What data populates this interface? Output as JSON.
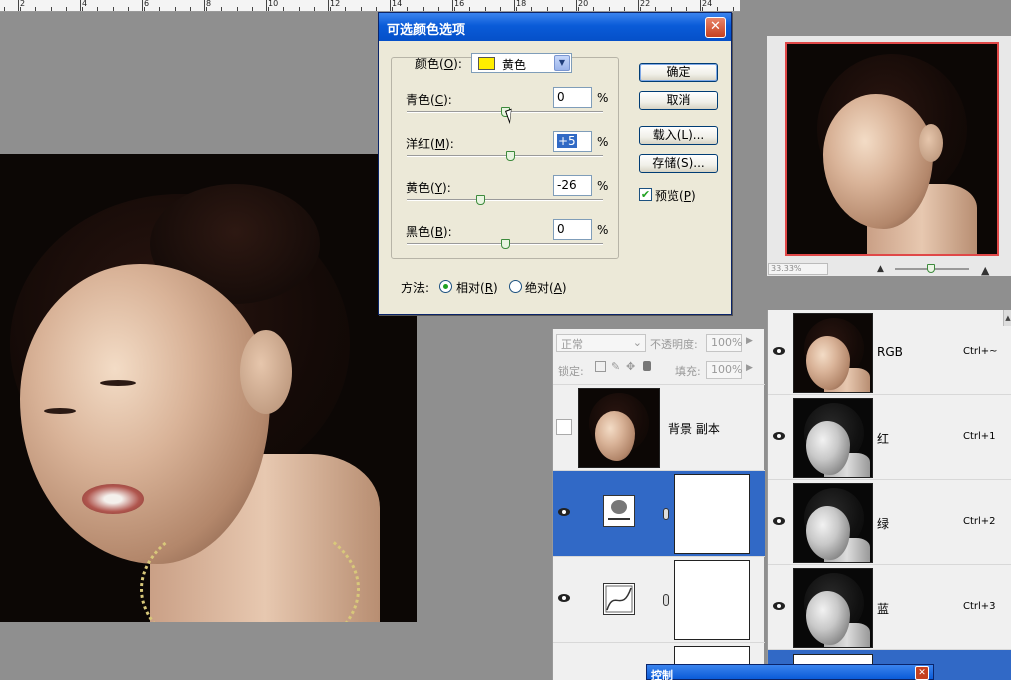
{
  "dialog": {
    "title": "可选颜色选项",
    "close_glyph": "✕",
    "colors_label": "颜色(",
    "colors_key": "O",
    "colors_suffix": "):",
    "color_value": "黄色",
    "swatch_color": "#ffee00",
    "sliders": [
      {
        "label": "青色(",
        "key": "C",
        "suffix": "):",
        "value": "0",
        "position": 0.5
      },
      {
        "label": "洋红(",
        "key": "M",
        "suffix": "):",
        "value": "+5",
        "position": 0.525
      },
      {
        "label": "黄色(",
        "key": "Y",
        "suffix": "):",
        "value": "-26",
        "position": 0.37
      },
      {
        "label": "黑色(",
        "key": "B",
        "suffix": "):",
        "value": "0",
        "position": 0.5
      }
    ],
    "percent": "%",
    "buttons": {
      "ok": "确定",
      "cancel": "取消",
      "load": "载入(L)...",
      "save": "存储(S)..."
    },
    "preview_label": "预览(",
    "preview_key": "P",
    "preview_suffix": ")",
    "method_label": "方法:",
    "relative_label": "相对(",
    "relative_key": "R",
    "relative_suffix": ")",
    "absolute_label": "绝对(",
    "absolute_key": "A",
    "absolute_suffix": ")"
  },
  "ruler": {
    "labels": [
      "2",
      "4",
      "6",
      "8",
      "10",
      "12",
      "14",
      "16",
      "18",
      "20",
      "22",
      "24"
    ]
  },
  "navigator": {
    "zoom": "33.33%",
    "frame_color": "#e04848"
  },
  "layers": {
    "blend_mode": "正常",
    "opacity_label": "不透明度:",
    "opacity_value": "100%",
    "lock_label": "锁定:",
    "fill_label": "填充:",
    "fill_value": "100%",
    "items": [
      {
        "name": "背景 副本"
      }
    ],
    "selected_color": "#3169c6"
  },
  "channels": {
    "items": [
      {
        "name": "RGB",
        "shortcut": "Ctrl+~"
      },
      {
        "name": "红",
        "shortcut": "Ctrl+1"
      },
      {
        "name": "绿",
        "shortcut": "Ctrl+2"
      },
      {
        "name": "蓝",
        "shortcut": "Ctrl+3"
      }
    ]
  },
  "control_window": {
    "title": "控制"
  }
}
